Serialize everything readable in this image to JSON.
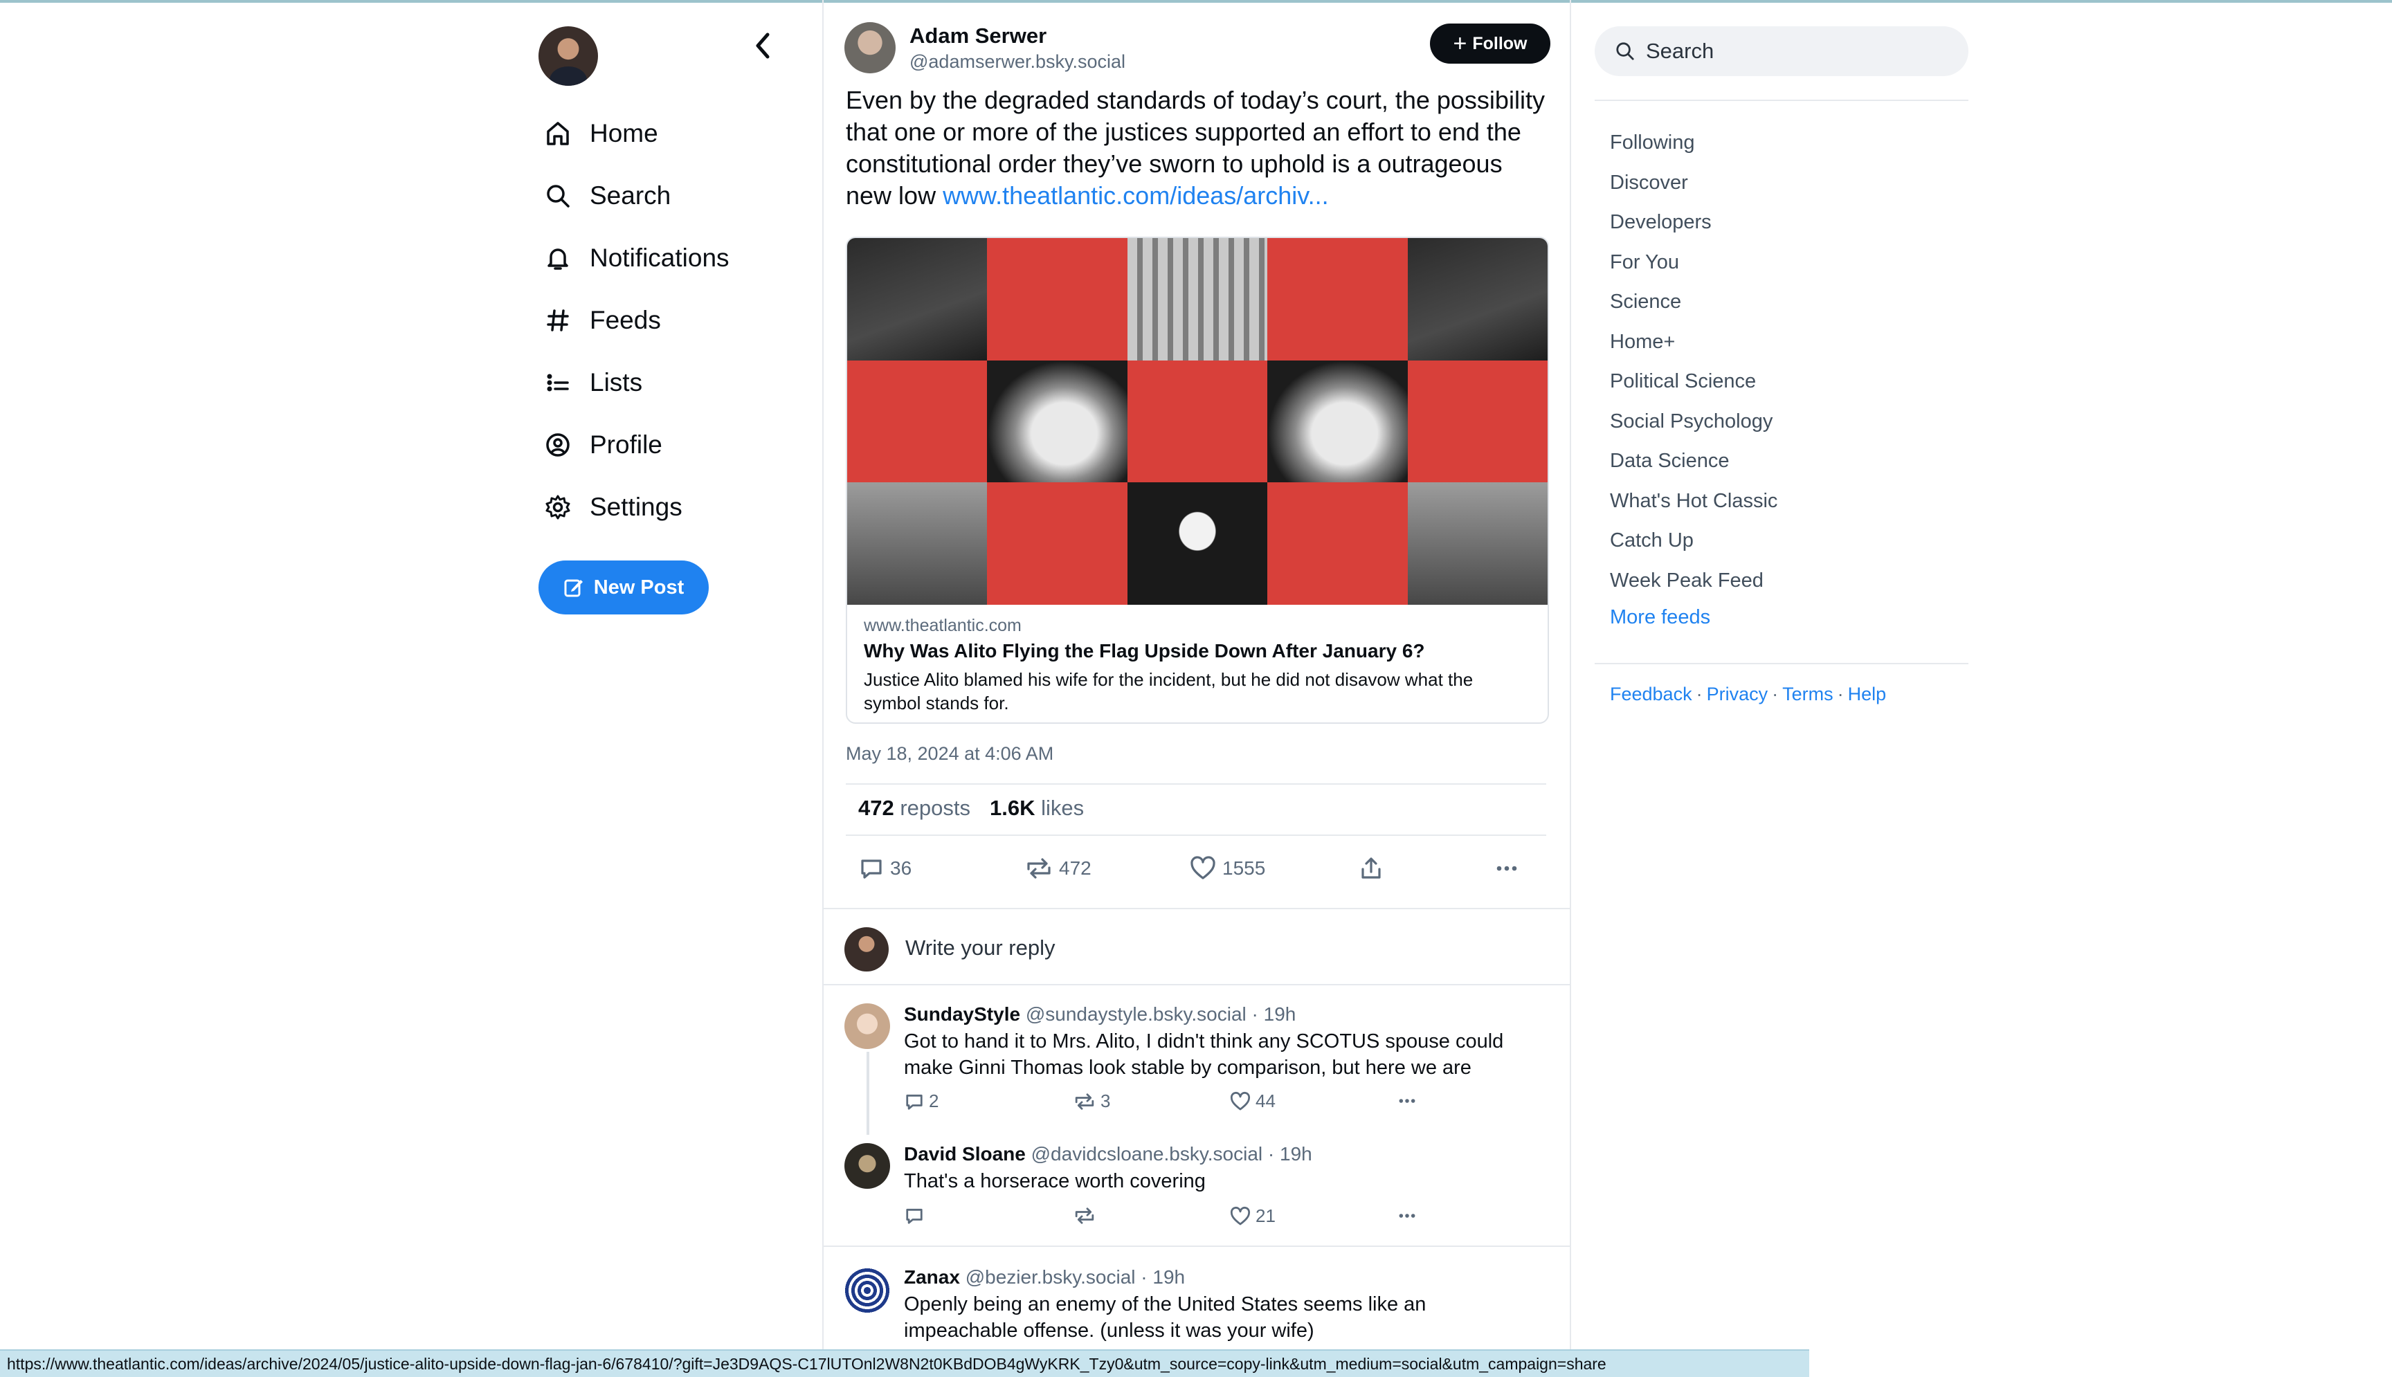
{
  "left_nav": {
    "items": [
      {
        "label": "Home",
        "icon": "home-icon"
      },
      {
        "label": "Search",
        "icon": "search-icon"
      },
      {
        "label": "Notifications",
        "icon": "bell-icon"
      },
      {
        "label": "Feeds",
        "icon": "hash-icon"
      },
      {
        "label": "Lists",
        "icon": "list-icon"
      },
      {
        "label": "Profile",
        "icon": "user-circle-icon"
      },
      {
        "label": "Settings",
        "icon": "gear-icon"
      }
    ],
    "new_post_label": "New Post"
  },
  "post": {
    "author_name": "Adam Serwer",
    "author_handle": "@adamserwer.bsky.social",
    "follow_label": "Follow",
    "text": "Even by the degraded standards of today’s court, the possibility that one or more of the justices supported an effort to end the constitutional order they’ve sworn to uphold is a outrageous new low ",
    "link_text": "www.theatlantic.com/ideas/archiv...",
    "card": {
      "domain": "www.theatlantic.com",
      "title": "Why Was Alito Flying the Flag Upside Down After January 6?",
      "description": "Justice Alito blamed his wife for the incident, but he did not disavow what the symbol stands for."
    },
    "timestamp": "May 18, 2024 at 4:06 AM",
    "reposts_count": "472",
    "reposts_label": "reposts",
    "likes_count": "1.6K",
    "likes_label": "likes",
    "actions": {
      "replies": "36",
      "reposts": "472",
      "likes": "1555"
    }
  },
  "reply_box": {
    "placeholder": "Write your reply"
  },
  "replies": [
    {
      "name": "SundayStyle",
      "handle": "@sundaystyle.bsky.social · 19h",
      "text": "Got to hand it to Mrs. Alito, I didn't think any SCOTUS spouse could make Ginni Thomas look stable by comparison, but here we are",
      "replies": "2",
      "reposts": "3",
      "likes": "44"
    },
    {
      "name": "David Sloane",
      "handle": "@davidcsloane.bsky.social · 19h",
      "text": "That's a horserace worth covering",
      "replies": "",
      "reposts": "",
      "likes": "21"
    },
    {
      "name": "Zanax",
      "handle": "@bezier.bsky.social · 19h",
      "text": "Openly being an enemy of the United States seems like an impeachable offense. (unless it was your wife)"
    }
  ],
  "right": {
    "search_placeholder": "Search",
    "feeds": [
      "Following",
      "Discover",
      "Developers",
      "For You",
      "Science",
      "Home+",
      "Political Science",
      "Social Psychology",
      "Data Science",
      "What's Hot Classic",
      "Catch Up",
      "Week Peak Feed"
    ],
    "more_feeds": "More feeds",
    "footer": [
      "Feedback",
      "Privacy",
      "Terms",
      "Help"
    ]
  },
  "status_url": "https://www.theatlantic.com/ideas/archive/2024/05/justice-alito-upside-down-flag-jan-6/678410/?gift=Je3D9AQS-C17lUTOnl2W8N2t0KBdDOB4gWyKRK_Tzy0&utm_source=copy-link&utm_medium=social&utm_campaign=share",
  "colors": {
    "accent": "#1f82f0",
    "text_muted": "#5b6a7b",
    "card_red": "#d8403a"
  }
}
